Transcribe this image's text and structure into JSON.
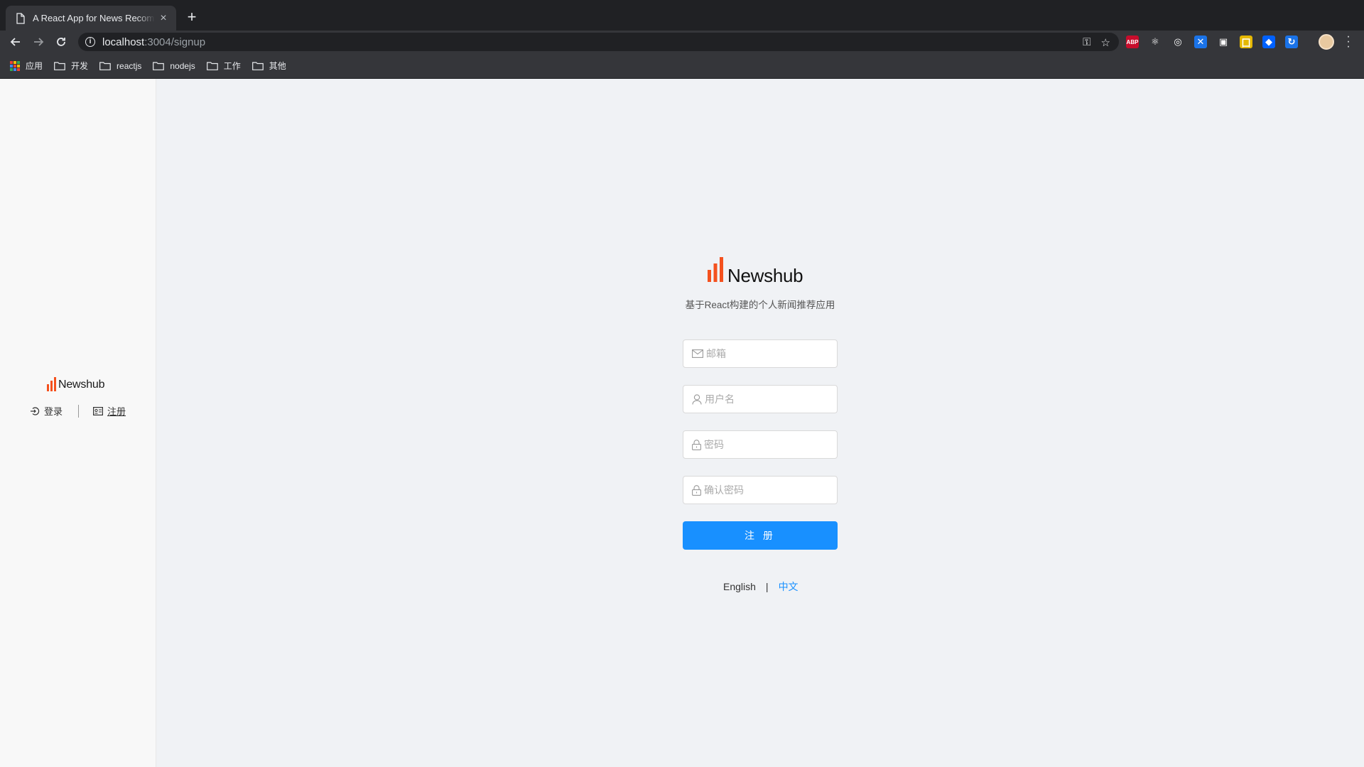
{
  "browser": {
    "tab_title": "A React App for News Recommendation",
    "url_host": "localhost",
    "url_path": ":3004/signup",
    "bookmarks": [
      {
        "label": "应用",
        "icon": "apps-grid-icon"
      },
      {
        "label": "开发",
        "icon": "folder-icon"
      },
      {
        "label": "reactjs",
        "icon": "folder-icon"
      },
      {
        "label": "nodejs",
        "icon": "folder-icon"
      },
      {
        "label": "工作",
        "icon": "folder-icon"
      },
      {
        "label": "其他",
        "icon": "folder-icon"
      }
    ],
    "extensions": [
      {
        "name": "adblock-plus-icon",
        "text": "ABP",
        "color": "#c70d2c"
      },
      {
        "name": "react-devtools-icon",
        "text": "⚛",
        "color": "#35363a"
      },
      {
        "name": "target-extension-icon",
        "text": "◎",
        "color": "#35363a"
      },
      {
        "name": "blue-extension-icon",
        "text": "✕",
        "color": "#1a73e8"
      },
      {
        "name": "window-extension-icon",
        "text": "▣",
        "color": "#35363a"
      },
      {
        "name": "yellow-extension-icon",
        "text": "囗",
        "color": "#e6b800"
      },
      {
        "name": "dropbox-extension-icon",
        "text": "◆",
        "color": "#0061ff"
      },
      {
        "name": "sync-extension-icon",
        "text": "↻",
        "color": "#1a73e8"
      }
    ]
  },
  "sidebar": {
    "logo_text": "Newshub",
    "login_label": "登录",
    "signup_label": "注册"
  },
  "main": {
    "logo_text": "Newshub",
    "tagline": "基于React构建的个人新闻推荐应用",
    "form": {
      "email_placeholder": "邮箱",
      "username_placeholder": "用户名",
      "password_placeholder": "密码",
      "confirm_placeholder": "确认密码",
      "submit_label": "注 册"
    },
    "lang": {
      "english": "English",
      "separator": "|",
      "chinese": "中文"
    }
  },
  "colors": {
    "brand_orange": "#f4511e",
    "primary_blue": "#1890ff"
  }
}
